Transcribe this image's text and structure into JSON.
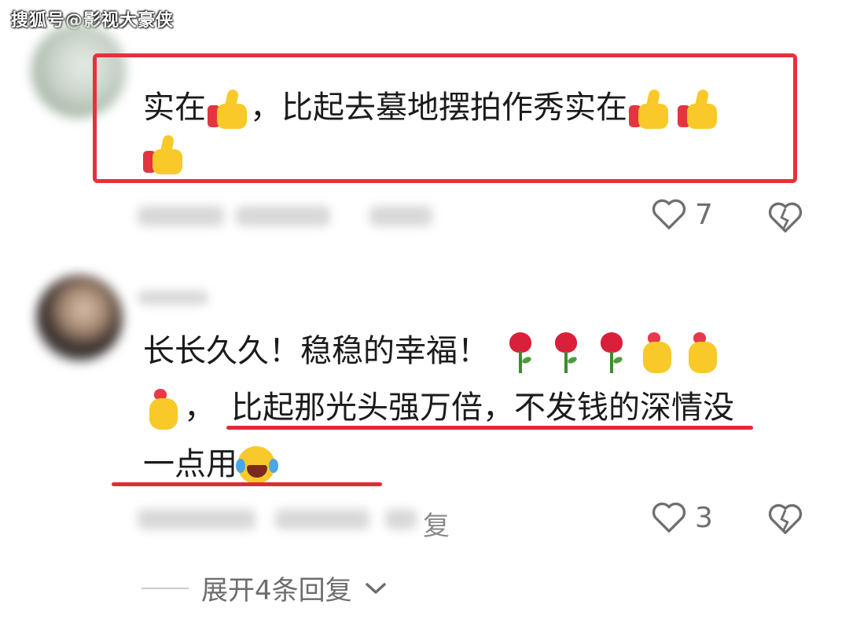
{
  "watermark": "搜狐号@影视大豪侠",
  "comments": [
    {
      "text_line1": "实在",
      "text_line1b": "，比起去墓地摆拍作秀实在",
      "likes": "7",
      "highlight_color": "#e6313c"
    },
    {
      "text_line1": "长长久久！稳稳的幸福！",
      "text_line2a": "，",
      "text_line2b": "比起那光头强万倍，不发钱的深情没",
      "text_line3": "一点用",
      "reply_fragment": "复",
      "likes": "3",
      "underline_color": "#e02a36"
    }
  ],
  "expand_replies": "展开4条回复",
  "icons": {
    "like": "heart-outline-icon",
    "dislike": "broken-heart-icon",
    "expand": "chevron-down-icon"
  }
}
